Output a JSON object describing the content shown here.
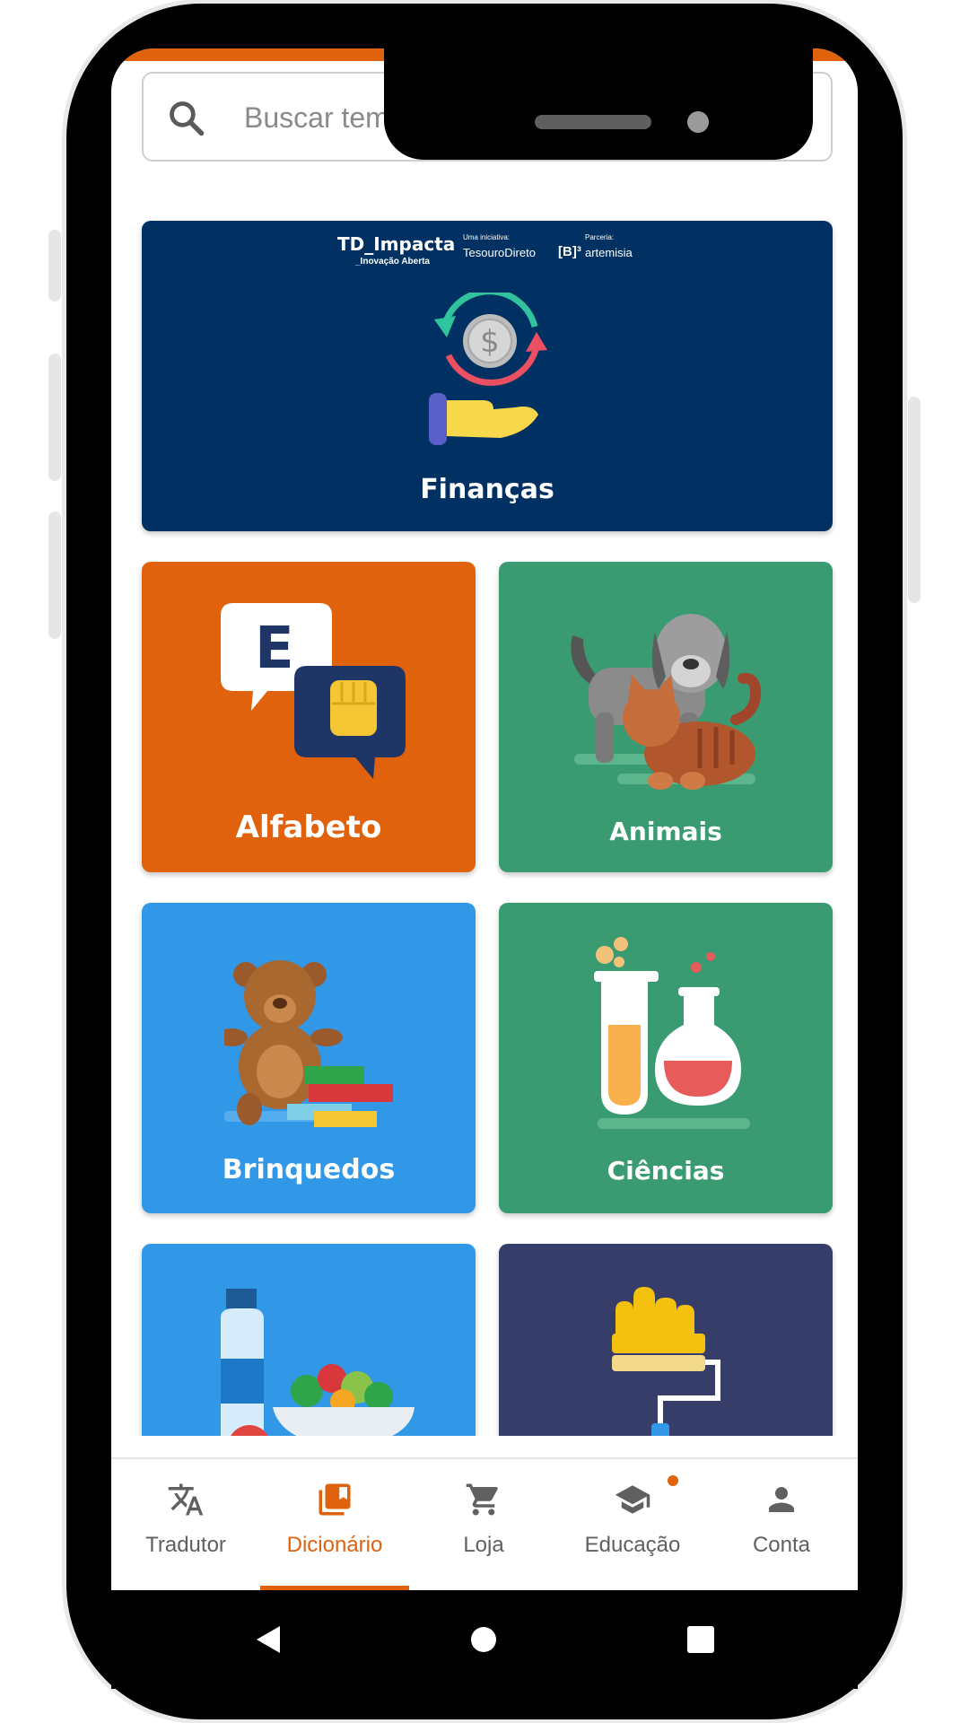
{
  "search": {
    "placeholder": "Buscar temas"
  },
  "banner": {
    "logo": {
      "brand": "TD_Impacta",
      "brand_sub": "_Inovação Aberta",
      "initiative_label": "Uma iniciativa:",
      "initiative": "TesouroDireto",
      "b3": "[B]³",
      "partner_label": "Parceria:",
      "partner": "artemisia"
    },
    "title": "Finanças",
    "color": "#003162"
  },
  "categories": [
    {
      "label": "Alfabeto",
      "color": "#e0620d",
      "icon": "speech-bubbles-icon"
    },
    {
      "label": "Animais",
      "color": "#3a9b72",
      "icon": "dog-and-cat-icon"
    },
    {
      "label": "Brinquedos",
      "color": "#3198e8",
      "icon": "teddy-bear-icon"
    },
    {
      "label": "Ciências",
      "color": "#3a9b72",
      "icon": "test-tubes-icon"
    },
    {
      "label": "",
      "color": "#3198e8",
      "icon": "food-bowl-icon"
    },
    {
      "label": "",
      "color": "#353d68",
      "icon": "paint-roller-icon"
    }
  ],
  "nav": [
    {
      "label": "Tradutor",
      "icon": "translate-icon",
      "active": false
    },
    {
      "label": "Dicionário",
      "icon": "library-book-icon",
      "active": true
    },
    {
      "label": "Loja",
      "icon": "cart-icon",
      "active": false
    },
    {
      "label": "Educação",
      "icon": "graduation-cap-icon",
      "active": false
    },
    {
      "label": "Conta",
      "icon": "person-icon",
      "active": false
    }
  ],
  "colors": {
    "accent": "#e0620d",
    "nav_text": "#606060"
  }
}
